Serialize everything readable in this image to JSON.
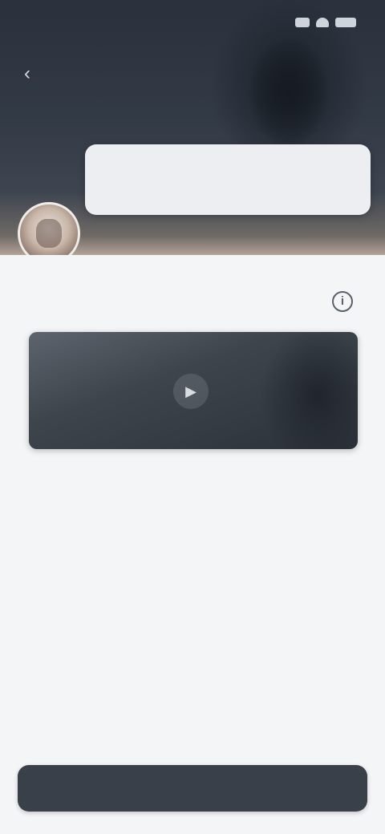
{
  "status_bar": {
    "time": "",
    "icons": [
      "signal-icon",
      "wifi-icon",
      "battery-icon"
    ]
  },
  "header": {
    "back_icon": "chevron-left-icon",
    "back_glyph": "‹",
    "title": ""
  },
  "speech_bubble": {
    "text": ""
  },
  "section": {
    "title": "",
    "info_icon": "info-icon",
    "info_glyph": "i"
  },
  "media": {
    "caption": "",
    "play_icon": "play-icon",
    "play_glyph": "▶"
  },
  "body": {
    "text": ""
  },
  "actions": {
    "secondary_label": "",
    "primary_label": ""
  },
  "colors": {
    "header_bg": "#2a313c",
    "primary_button": "#3a4049",
    "content_bg": "#f4f5f7"
  }
}
